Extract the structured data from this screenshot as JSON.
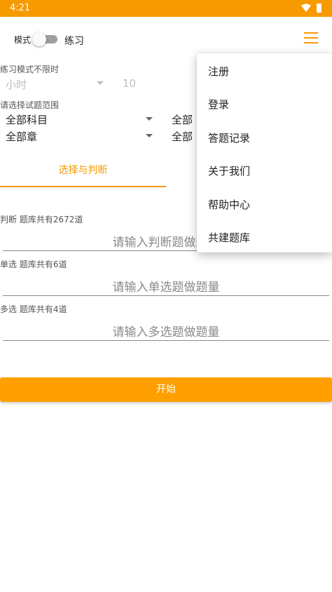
{
  "status_bar": {
    "time": "4:21"
  },
  "toolbar": {
    "mode_label": "模式",
    "practice_label": "练习"
  },
  "practice": {
    "no_time_limit_label": "练习模式不限时",
    "hours_placeholder": "小时",
    "minutes_value": "10"
  },
  "scope": {
    "label": "请选择试题范围",
    "subject_value": "全部科目",
    "right_top_partial": "全部",
    "chapter_value": "全部章",
    "right_bottom_partial": "全部"
  },
  "tabs": [
    {
      "label": "选择与判断",
      "active": true
    }
  ],
  "question_types": [
    {
      "label": "判断 题库共有2672道",
      "placeholder": "请输入判断题做题量"
    },
    {
      "label": "单选 题库共有6道",
      "placeholder": "请输入单选题做题量"
    },
    {
      "label": "多选 题库共有4道",
      "placeholder": "请输入多选题做题量"
    }
  ],
  "start_button": {
    "label": "开始"
  },
  "popup_menu": {
    "items": [
      "注册",
      "登录",
      "答题记录",
      "关于我们",
      "帮助中心",
      "共建题库"
    ]
  },
  "colors": {
    "accent": "#f79a00",
    "button": "#ffa000"
  },
  "icons": {
    "wifi": "wifi-icon",
    "battery": "battery-icon",
    "menu": "hamburger-menu-icon"
  }
}
